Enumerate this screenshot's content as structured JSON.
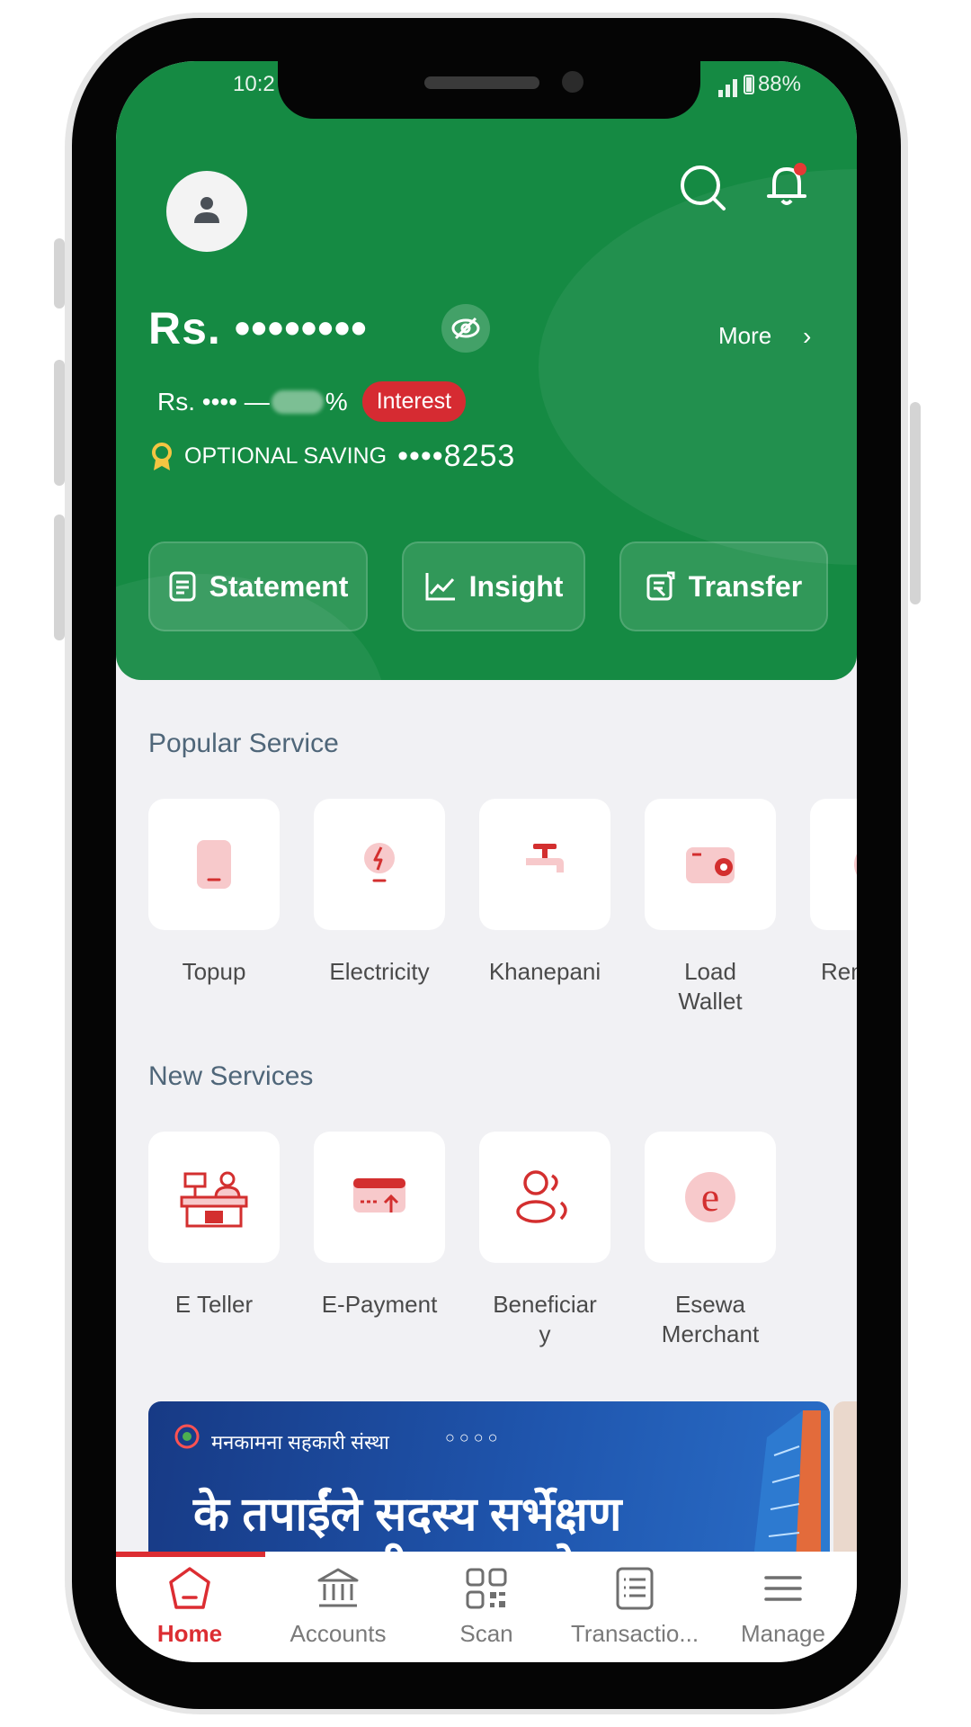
{
  "status_bar": {
    "time": "10:2",
    "battery": "88%"
  },
  "header": {
    "balance": "Rs. ••••••••",
    "more_label": "More",
    "rate_prefix": "Rs. •••• —",
    "rate_suffix": "%",
    "interest_badge": "Interest",
    "account_type": "OPTIONAL SAVING",
    "account_number": "••••8253",
    "actions": [
      {
        "label": "Statement",
        "icon": "document-icon"
      },
      {
        "label": "Insight",
        "icon": "chart-line-icon"
      },
      {
        "label": "Transfer",
        "icon": "transfer-icon"
      }
    ]
  },
  "popular": {
    "title": "Popular Service",
    "items": [
      {
        "label": "Topup",
        "icon": "phone-icon"
      },
      {
        "label": "Electricity",
        "icon": "bulb-icon"
      },
      {
        "label": "Khanepani",
        "icon": "tap-icon"
      },
      {
        "label": "Load Wallet",
        "label_line1": "Load",
        "label_line2": "Wallet",
        "icon": "wallet-icon"
      },
      {
        "label": "Rem",
        "icon": "remit-icon"
      }
    ]
  },
  "new_services": {
    "title": "New Services",
    "items": [
      {
        "label": "E Teller",
        "icon": "teller-icon"
      },
      {
        "label": "E-Payment",
        "icon": "card-upload-icon"
      },
      {
        "label_line1": "Beneficiar",
        "label_line2": "y",
        "icon": "people-icon"
      },
      {
        "label_line1": "Esewa",
        "label_line2": "Merchant",
        "icon": "esewa-icon"
      }
    ]
  },
  "banner": {
    "org": "मनकामना सहकारी संस्था",
    "dots": "○○○○",
    "headline1": "के तपाईंले सदस्य सर्भेक्षण",
    "headline2": "फाराम भरीसक्नु भयो?"
  },
  "bottom_nav": [
    {
      "label": "Home",
      "active": true
    },
    {
      "label": "Accounts",
      "active": false
    },
    {
      "label": "Scan",
      "active": false
    },
    {
      "label": "Transactio...",
      "active": false
    },
    {
      "label": "Manage",
      "active": false
    }
  ],
  "colors": {
    "primary_green": "#158a43",
    "accent_red": "#dc2d32",
    "tile_icon_pink": "#f7c9cb"
  }
}
